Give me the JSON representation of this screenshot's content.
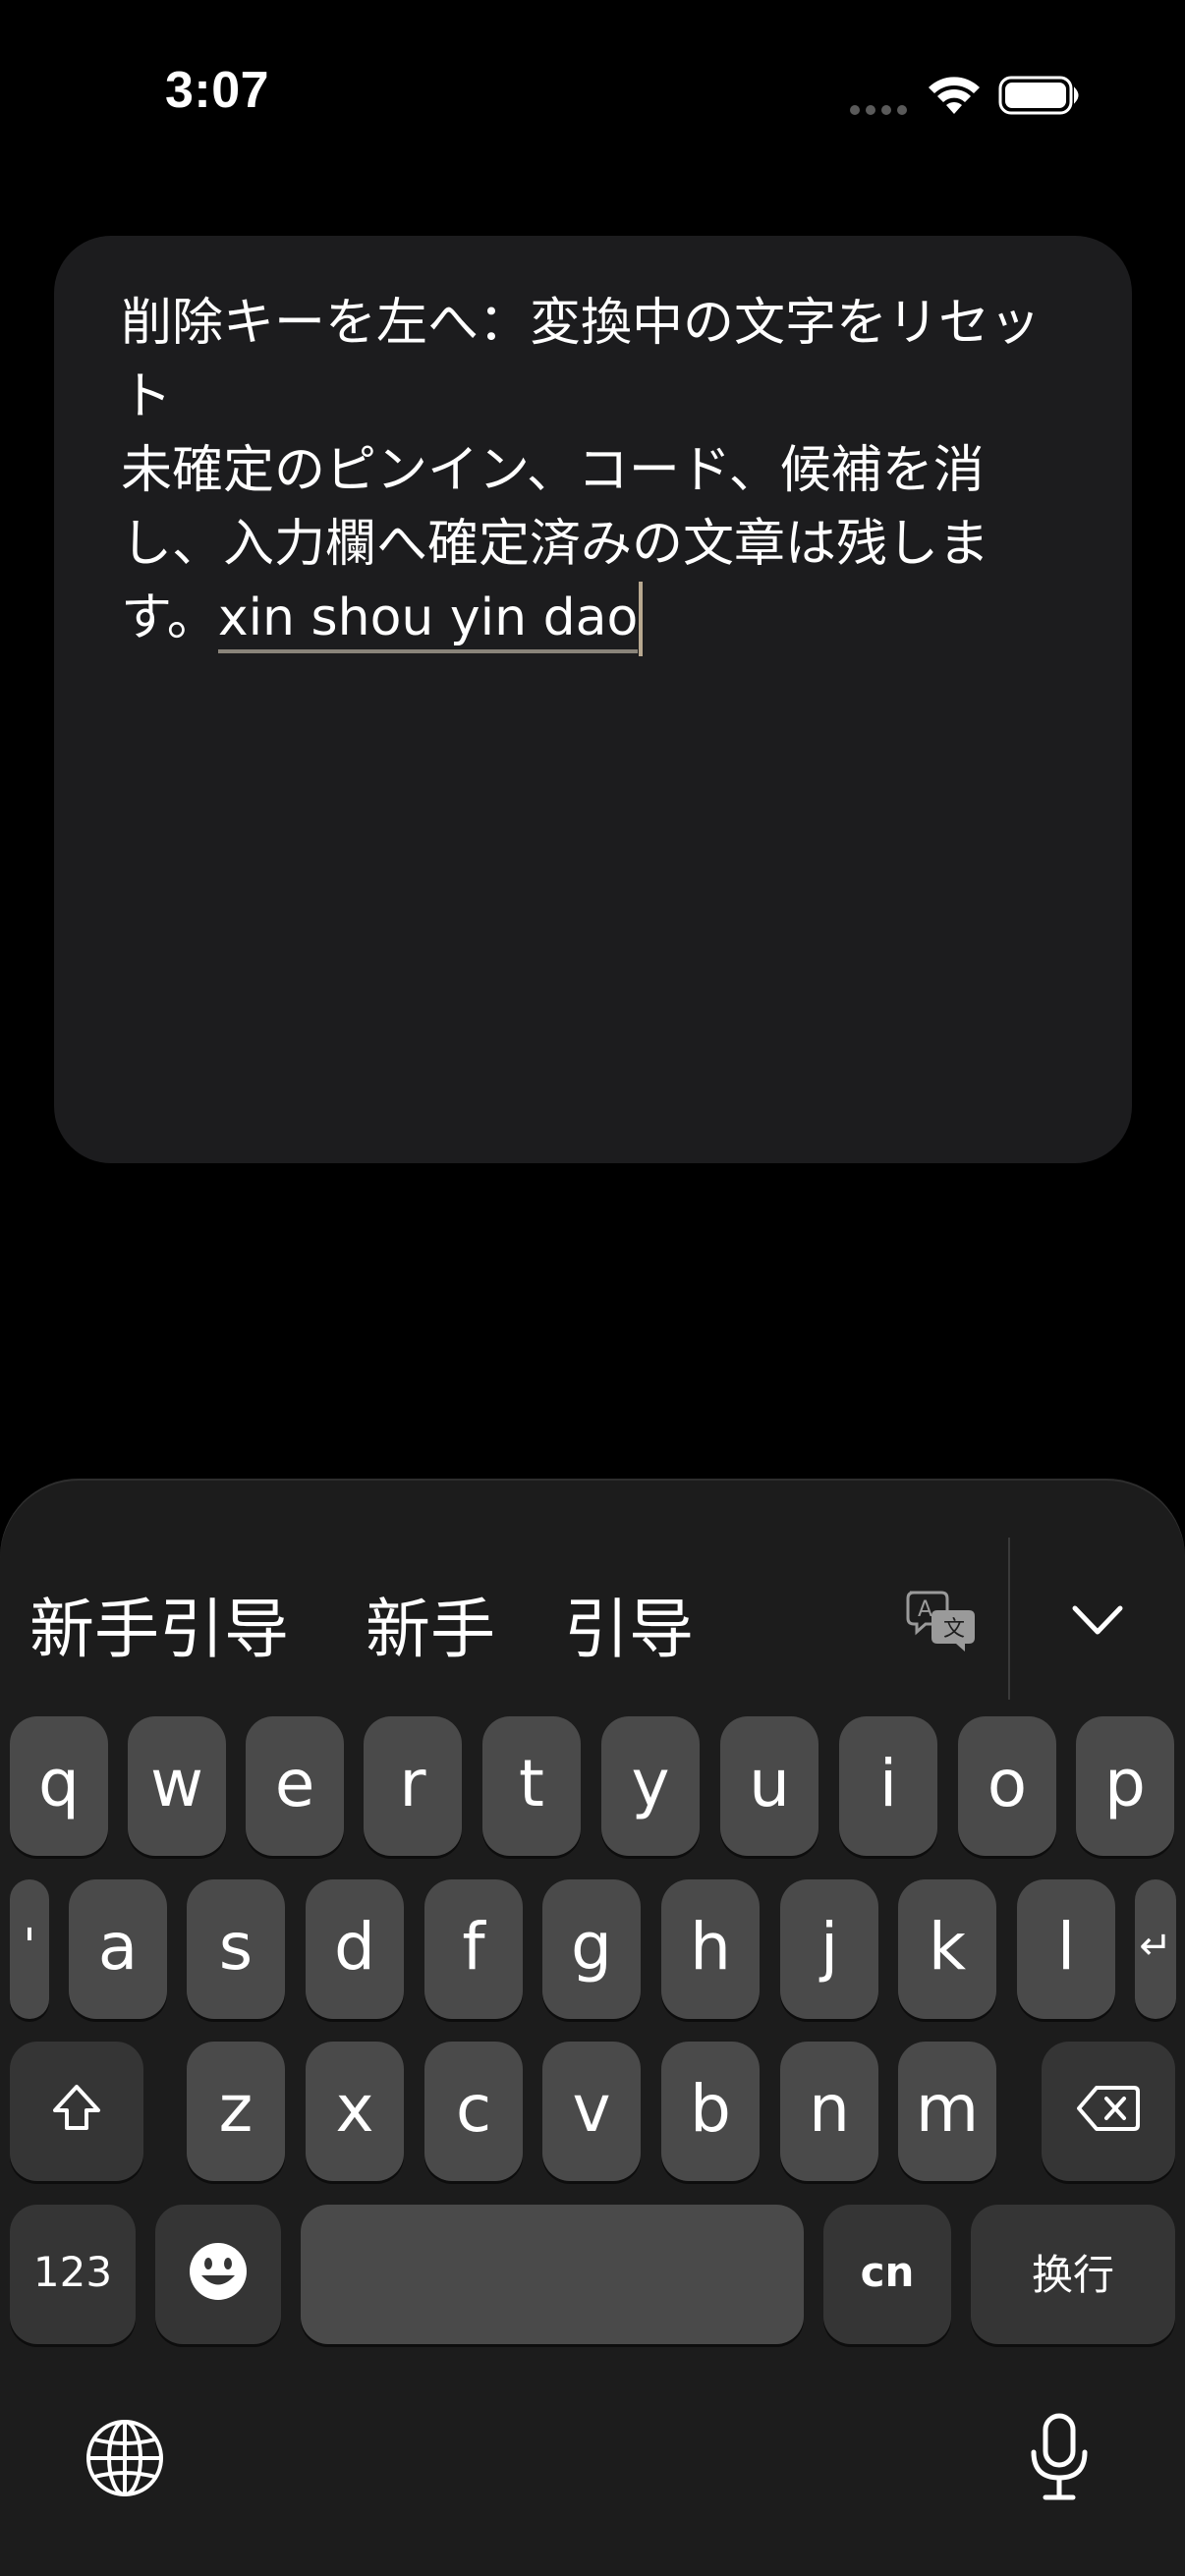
{
  "status_bar": {
    "time": "3:07",
    "icons": [
      "signal-dots-icon",
      "wifi-icon",
      "battery-icon"
    ]
  },
  "text_field": {
    "committed_text": "削除キーを左へ：変換中の文字をリセット\n未確定のピンイン、コード、候補を消し、入力欄へ確定済みの文章は残します。",
    "marked_text": "xin shou yin dao"
  },
  "candidates": {
    "items": [
      "新手引导",
      "新手",
      "引导"
    ],
    "icons": [
      "translate-icon",
      "chevron-down-icon"
    ]
  },
  "keyboard": {
    "row1": [
      "q",
      "w",
      "e",
      "r",
      "t",
      "y",
      "u",
      "i",
      "o",
      "p"
    ],
    "row2": [
      "'",
      "a",
      "s",
      "d",
      "f",
      "g",
      "h",
      "j",
      "k",
      "l",
      "↵"
    ],
    "row3": [
      "z",
      "x",
      "c",
      "v",
      "b",
      "n",
      "m"
    ],
    "numbers_label": "123",
    "space_label": "",
    "language_label": "cn",
    "return_label": "换行",
    "icons": [
      "shift-icon",
      "delete-icon",
      "emoji-icon",
      "globe-icon",
      "microphone-icon"
    ]
  },
  "colors": {
    "background": "#000000",
    "card": "#1c1c1e",
    "keyboard": "#1c1c1c",
    "key": "#4a4a4a",
    "function_key": "#353535",
    "caret": "#b8a890"
  }
}
